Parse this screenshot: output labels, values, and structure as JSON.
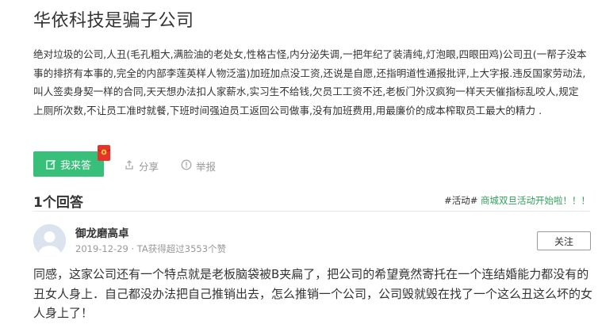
{
  "question": {
    "title": "华依科技是骗子公司",
    "description": "绝对垃圾的公司,人丑(毛孔粗大,满脸油的老处女,性格古怪,内分泌失调,一把年纪了装清纯,灯泡眼,四眼田鸡)公司丑(一帮子没本事的排挤有本事的,完全的内部李莲英样人物泛滥)加班加点没工资,还说是自愿,还指明道性通报批评,上大字报.违反国家劳动法,叫人签卖身契一样的合同,天天想办法扣人家薪水,实习生不给钱,欠员工工资不还,老板门外汉疯狗一样天天催指标乱咬人,规定上厕所次数,不让员工准时就餐,下班时间强迫员工返回公司做事,没有加班费用,用最廉价的成本榨取员工最大的精力 ."
  },
  "actions": {
    "answer_label": "我来答",
    "share_label": "分享",
    "report_label": "举报"
  },
  "answers": {
    "count_label": "1个回答",
    "promo_tag": "#活动#",
    "promo_link": "商城双旦活动开始啦！！！"
  },
  "answer": {
    "author": "御龙磨高卓",
    "meta": "2019-12-29 · TA获得超过3553个赞",
    "follow_label": "关注",
    "text": "同感，这家公司还有一个特点就是老板脑袋被B夹扁了，把公司的希望竟然寄托在一个连结婚能力都没有的丑女人身上．自己都没办法把自己推销出去，怎么推销一个公司，公司毁就毁在找了一个这么丑这么坏的女人身上了！"
  },
  "colors": {
    "accent": "#38c07a",
    "link": "#2e9e5b",
    "muted": "#999999"
  },
  "icons": [
    "edit-icon",
    "red-packet-icon",
    "share-icon",
    "report-icon",
    "avatar-placeholder"
  ]
}
